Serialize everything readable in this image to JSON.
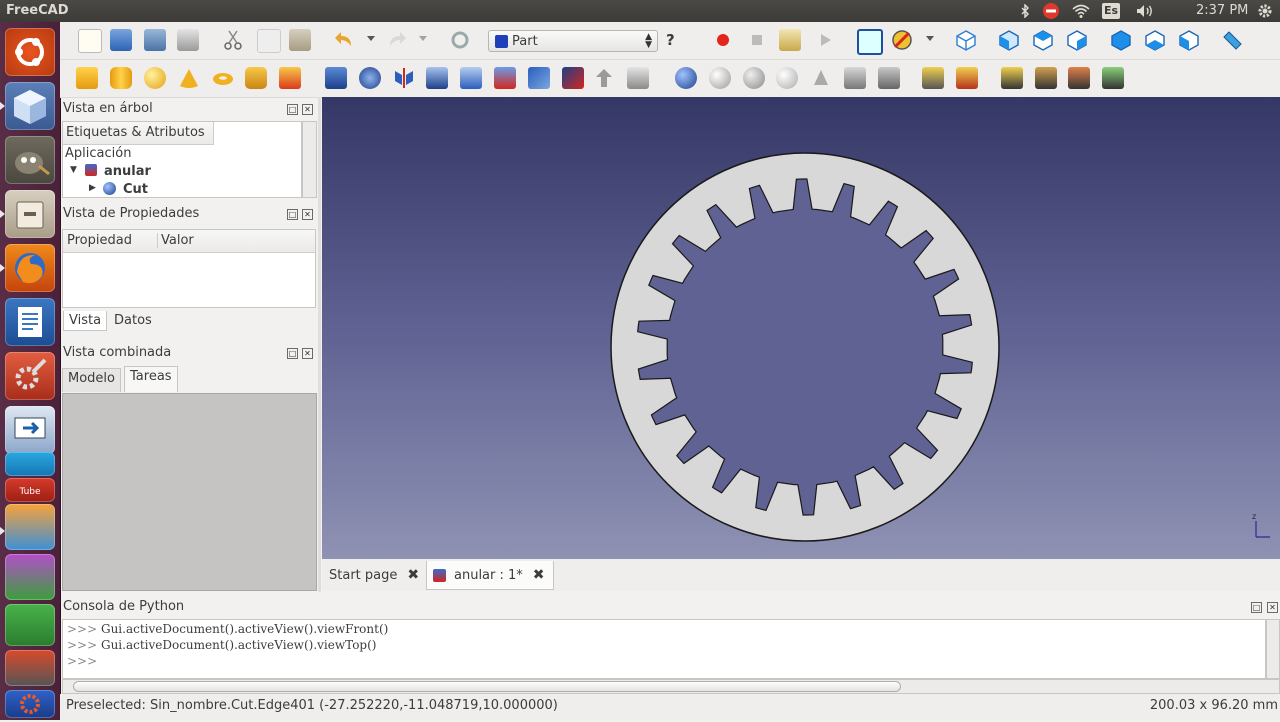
{
  "topbar": {
    "app_title": "FreeCAD",
    "language": "Es",
    "clock": "2:37 PM"
  },
  "toolbar": {
    "workbench": "Part",
    "whats_this": "?"
  },
  "tree_view": {
    "title": "Vista en árbol",
    "header": "Etiquetas & Atributos",
    "application_label": "Aplicación",
    "document": "anular",
    "child": "Cut"
  },
  "property_view": {
    "title": "Vista de Propiedades",
    "col_property": "Propiedad",
    "col_value": "Valor",
    "tab_view": "Vista",
    "tab_data": "Datos"
  },
  "combo_view": {
    "title": "Vista combinada",
    "tab_model": "Modelo",
    "tab_tasks": "Tareas"
  },
  "document_tabs": {
    "start_page": "Start page",
    "current_doc": "anular : 1*"
  },
  "python_console": {
    "title": "Consola de Python",
    "lines": [
      {
        "prompt": ">>> ",
        "code": "Gui.activeDocument().activeView().viewFront()"
      },
      {
        "prompt": ">>> ",
        "code": "Gui.activeDocument().activeView().viewTop()"
      },
      {
        "prompt": ">>> ",
        "code": ""
      }
    ]
  },
  "statusbar": {
    "message": "Preselected: Sin_nombre.Cut.Edge401 (-27.252220,-11.048719,10.000000)",
    "dimensions": "200.03 x 96.20 mm"
  },
  "gear": {
    "teeth": 22
  },
  "colors": {
    "part_face": "#d8d8d8",
    "view_top": "#353866",
    "view_bottom": "#8f92b3",
    "launcher": "#5a2d47"
  }
}
